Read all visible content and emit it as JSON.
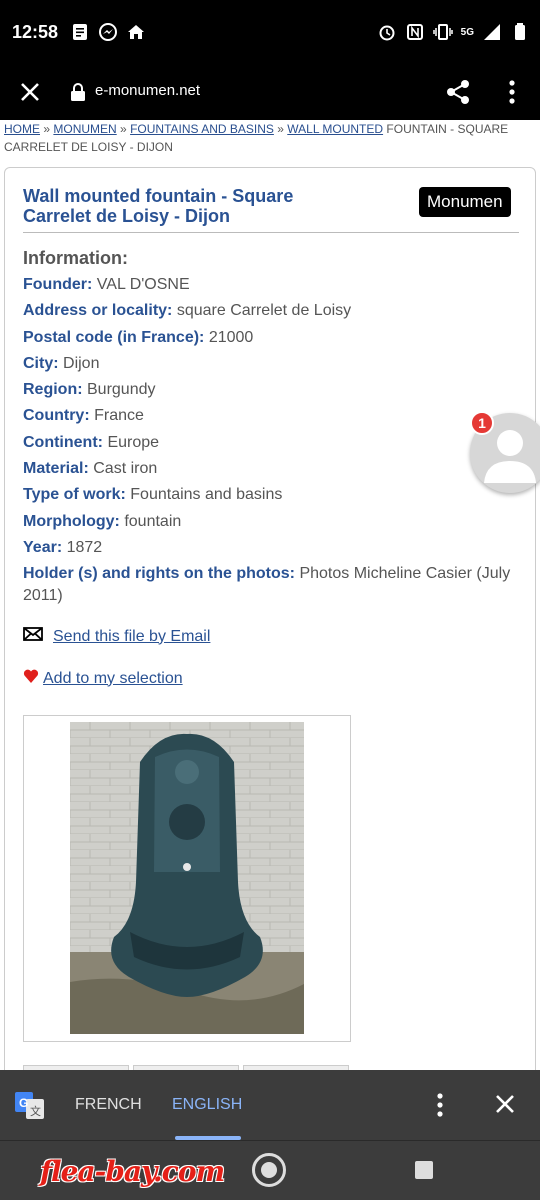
{
  "status": {
    "time": "12:58",
    "network": "5G"
  },
  "browser": {
    "url": "e-monumen.net"
  },
  "breadcrumb": {
    "items": [
      "HOME",
      "MONUMEN",
      "FOUNTAINS AND BASINS",
      "WALL MOUNTED"
    ],
    "separator": "»",
    "current": "FOUNTAIN - SQUARE CARRELET DE LOISY - DIJON"
  },
  "card": {
    "title": "Wall mounted fountain - Square Carrelet de Loisy - Dijon",
    "badge": "Monumen",
    "info_heading": "Information:",
    "fields": [
      {
        "key": "Founder:",
        "value": "VAL D'OSNE"
      },
      {
        "key": "Address or locality:",
        "value": "square Carrelet de Loisy"
      },
      {
        "key": "Postal code (in France):",
        "value": "21000"
      },
      {
        "key": "City:",
        "value": "Dijon"
      },
      {
        "key": "Region:",
        "value": "Burgundy"
      },
      {
        "key": "Country:",
        "value": "France"
      },
      {
        "key": "Continent:",
        "value": "Europe"
      },
      {
        "key": "Material:",
        "value": "Cast iron"
      },
      {
        "key": "Type of work:",
        "value": "Fountains and basins"
      },
      {
        "key": "Morphology:",
        "value": "fountain"
      },
      {
        "key": "Year:",
        "value": "1872"
      },
      {
        "key": "Holder (s) and rights on the photos:",
        "value": "Photos Micheline Casier (July 2011)"
      }
    ],
    "email_link": "Send this file by Email",
    "selection_link": "Add to my selection"
  },
  "chat_head": {
    "badge_count": "1"
  },
  "translate_bar": {
    "lang_from": "FRENCH",
    "lang_to": "ENGLISH"
  },
  "nav": {
    "watermark": "flea-bay.com"
  },
  "colors": {
    "link": "#2a5293",
    "accent_translate": "#8ab4f8",
    "badge_red": "#e53935"
  }
}
